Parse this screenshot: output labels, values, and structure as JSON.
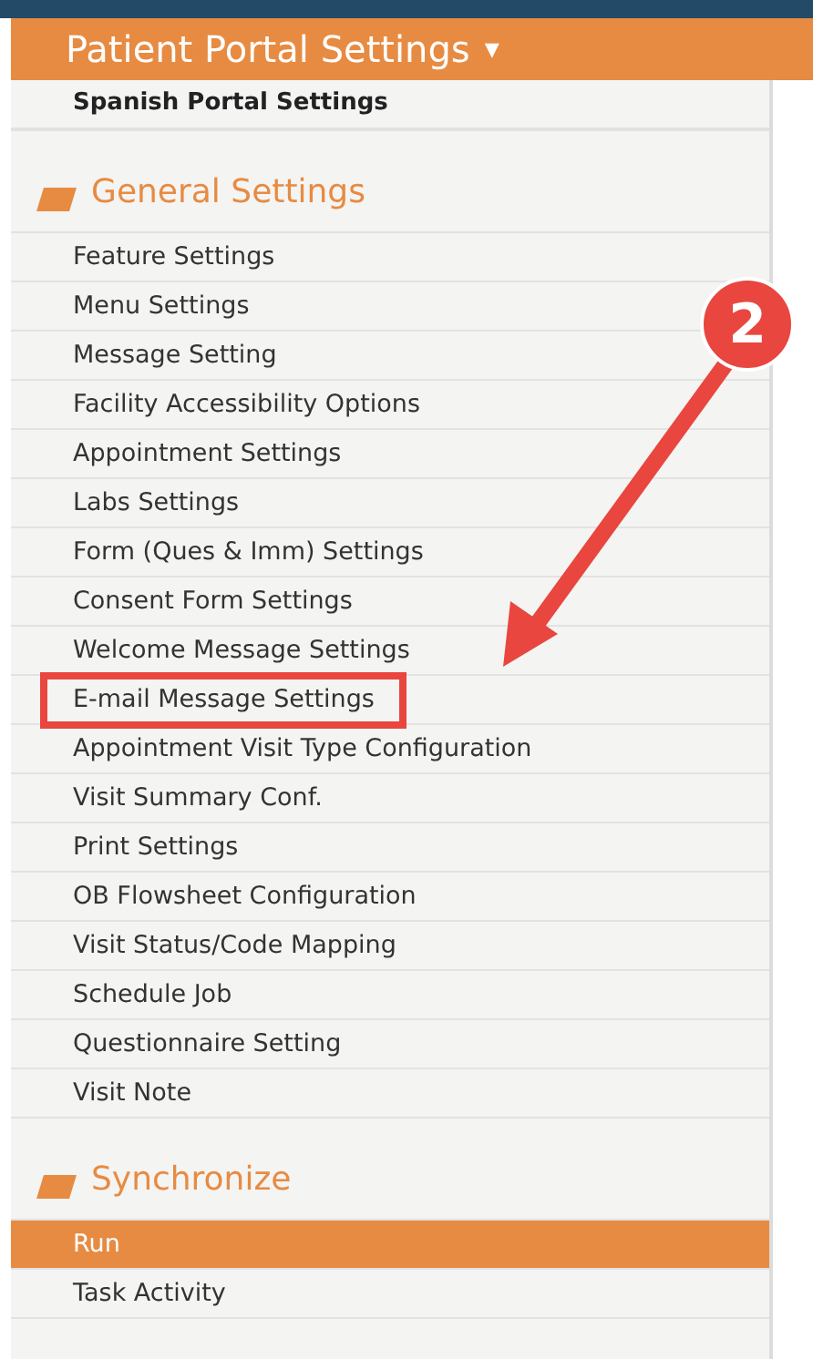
{
  "header": {
    "title": "Patient Portal Settings",
    "caret": "▾"
  },
  "top_item": {
    "label": "Spanish Portal Settings"
  },
  "sections": [
    {
      "title": "General Settings",
      "items": [
        {
          "label": "Feature Settings",
          "selected": false,
          "highlighted": false
        },
        {
          "label": "Menu Settings",
          "selected": false,
          "highlighted": false
        },
        {
          "label": "Message Setting",
          "selected": false,
          "highlighted": false
        },
        {
          "label": "Facility Accessibility Options",
          "selected": false,
          "highlighted": false
        },
        {
          "label": "Appointment Settings",
          "selected": false,
          "highlighted": false
        },
        {
          "label": "Labs Settings",
          "selected": false,
          "highlighted": false
        },
        {
          "label": "Form (Ques & Imm) Settings",
          "selected": false,
          "highlighted": false
        },
        {
          "label": "Consent Form Settings",
          "selected": false,
          "highlighted": false
        },
        {
          "label": "Welcome Message Settings",
          "selected": false,
          "highlighted": false
        },
        {
          "label": "E-mail Message Settings",
          "selected": false,
          "highlighted": true
        },
        {
          "label": "Appointment Visit Type Configuration",
          "selected": false,
          "highlighted": false
        },
        {
          "label": "Visit Summary Conf.",
          "selected": false,
          "highlighted": false
        },
        {
          "label": "Print Settings",
          "selected": false,
          "highlighted": false
        },
        {
          "label": "OB Flowsheet Configuration",
          "selected": false,
          "highlighted": false
        },
        {
          "label": "Visit Status/Code Mapping",
          "selected": false,
          "highlighted": false
        },
        {
          "label": "Schedule Job",
          "selected": false,
          "highlighted": false
        },
        {
          "label": "Questionnaire Setting",
          "selected": false,
          "highlighted": false
        },
        {
          "label": "Visit Note",
          "selected": false,
          "highlighted": false
        }
      ]
    },
    {
      "title": "Synchronize",
      "items": [
        {
          "label": "Run",
          "selected": true,
          "highlighted": false
        },
        {
          "label": "Task Activity",
          "selected": false,
          "highlighted": false
        }
      ]
    }
  ],
  "callout": {
    "number": "2"
  }
}
